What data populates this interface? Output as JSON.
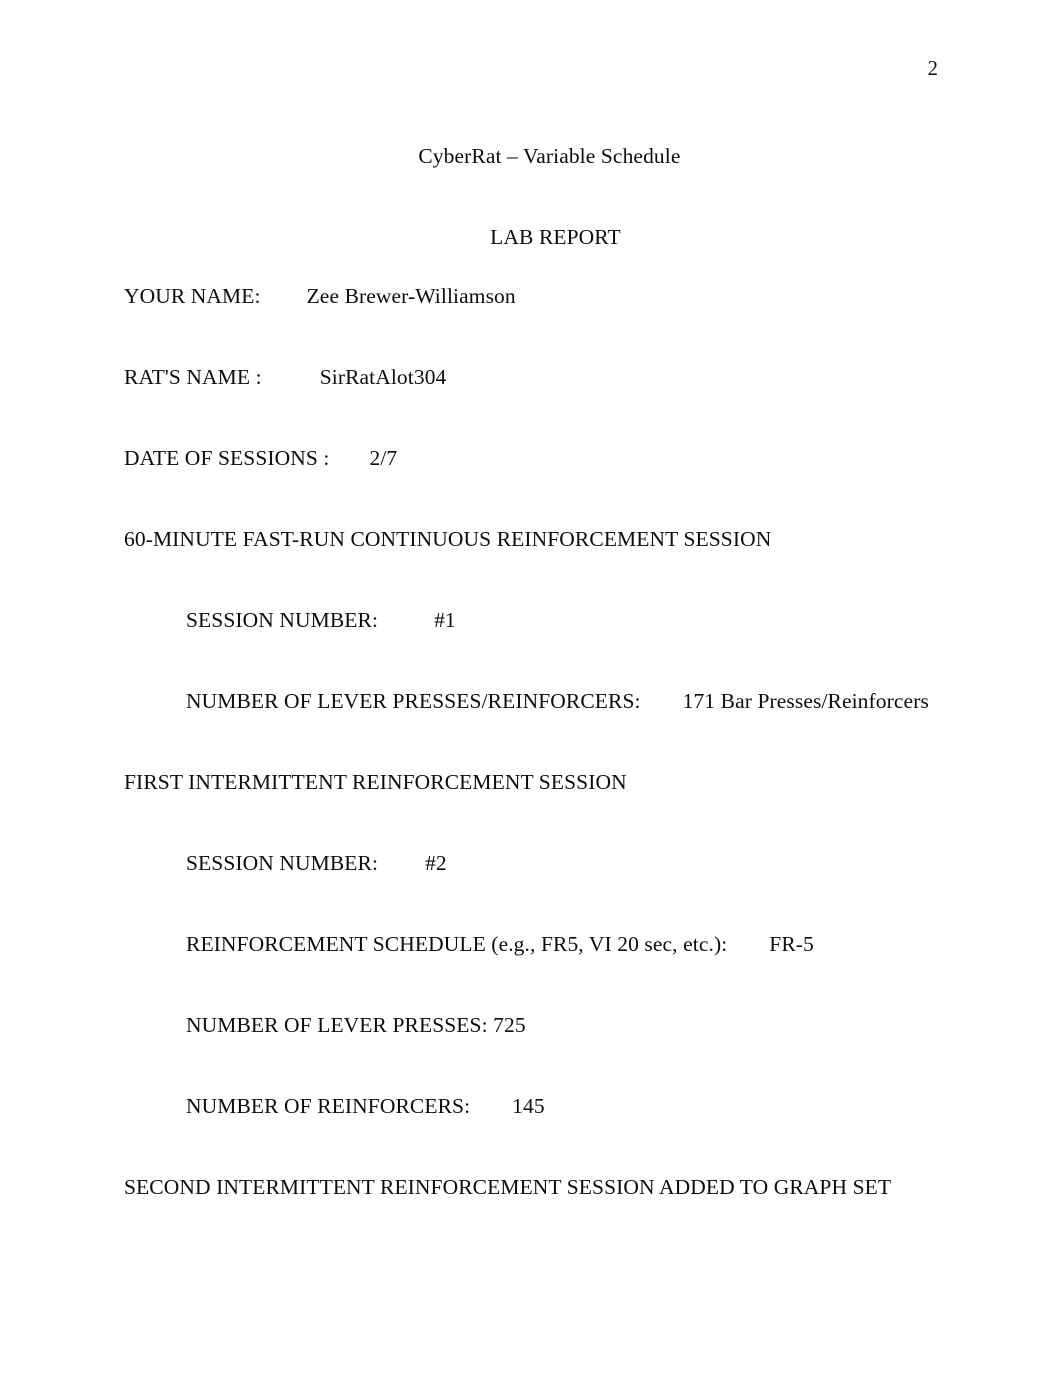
{
  "document": {
    "page_number": "2",
    "title": "CyberRat – Variable Schedule",
    "subtitle": "LAB REPORT",
    "fields": {
      "your_name_label": "YOUR NAME:",
      "your_name_value": "Zee Brewer-Williamson",
      "rats_name_label": "RAT'S NAME :",
      "rats_name_value": "SirRatAlot304",
      "date_of_sessions_label": "DATE OF SESSIONS :",
      "date_of_sessions_value": "2/7"
    },
    "section_one": {
      "heading": "60-MINUTE FAST-RUN CONTINUOUS REINFORCEMENT SESSION",
      "session_number_label": "SESSION NUMBER:",
      "session_number_value": "#1",
      "presses_label": "NUMBER OF LEVER PRESSES/REINFORCERS:",
      "presses_value": "171 Bar Presses/Reinforcers"
    },
    "section_two": {
      "heading": "FIRST INTERMITTENT REINFORCEMENT SESSION",
      "session_number_label": "SESSION NUMBER:",
      "session_number_value": "#2",
      "schedule_label": "REINFORCEMENT SCHEDULE (e.g., FR5, VI 20 sec, etc.):",
      "schedule_value": "FR-5",
      "lever_presses_line": "NUMBER OF LEVER PRESSES: 725",
      "reinforcers_label": "NUMBER OF REINFORCERS:",
      "reinforcers_value": "145"
    },
    "section_three": {
      "heading": "SECOND INTERMITTENT REINFORCEMENT SESSION ADDED TO GRAPH SET"
    }
  }
}
